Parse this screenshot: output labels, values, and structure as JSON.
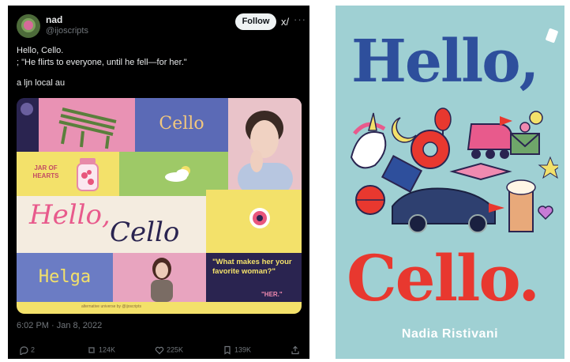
{
  "tweet": {
    "name": "nad",
    "handle": "@ijoscripts",
    "follow_label": "Follow",
    "lines": [
      "Hello, Cello.",
      "; \"He flirts to everyone, until he fell—for her.\"",
      "a ljn local au"
    ],
    "timestamp": "6:02 PM · Jan 8, 2022",
    "actions": {
      "replies": "2",
      "retweets": "124K",
      "likes": "225K",
      "bookmarks": "139K"
    }
  },
  "collage": {
    "cello": "Cello",
    "jar": "JAR OF\nHEARTS",
    "hello": "Hello,",
    "cello_script": "Cello",
    "helga": "Helga",
    "quote": "\"What makes her your favorite woman?\"",
    "her": "\"HER.\"",
    "credit": "alternative universe by @ijoscripts"
  },
  "book": {
    "title_line1": "Hello,",
    "title_line2": "Cello.",
    "author": "Nadia Ristivani"
  },
  "colors": {
    "accent_blue": "#2e4f9c",
    "accent_red": "#e8382f",
    "cover_bg": "#9fd0d3"
  }
}
